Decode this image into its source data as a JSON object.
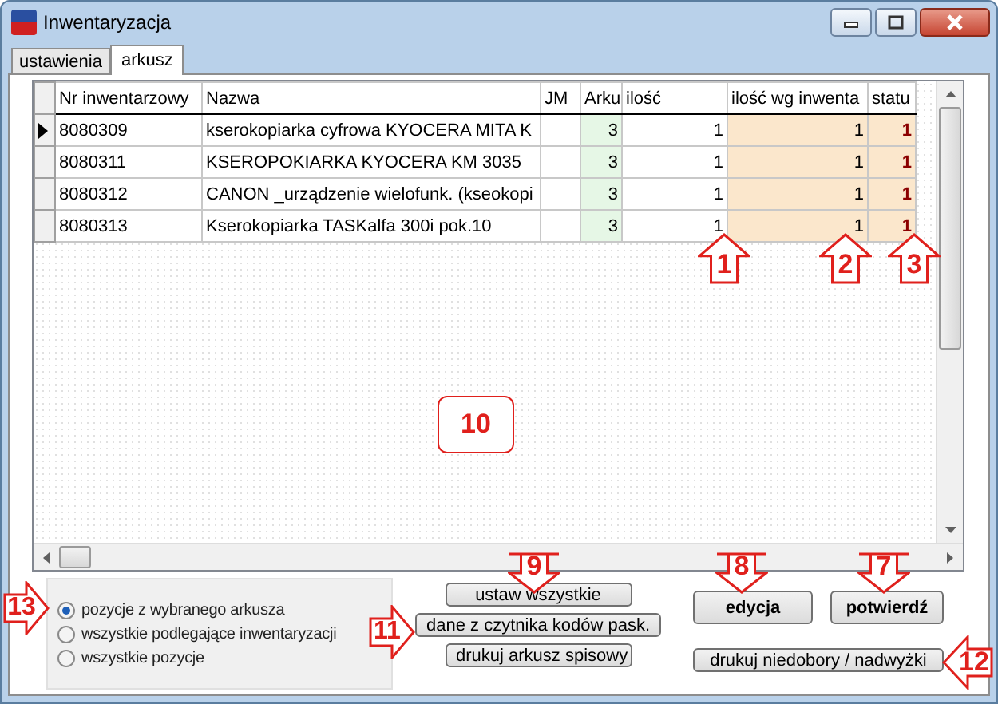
{
  "window": {
    "title": "Inwentaryzacja"
  },
  "tabs": [
    {
      "label": "ustawienia",
      "selected": false
    },
    {
      "label": "arkusz",
      "selected": true
    }
  ],
  "table": {
    "columns": [
      "Nr inwentarzowy",
      "Nazwa",
      "JM",
      "Arku",
      "ilość",
      "ilość wg inwenta",
      "statu"
    ],
    "rows": [
      {
        "current": true,
        "cells": [
          "8080309",
          "kserokopiarka cyfrowa KYOCERA MITA K",
          "",
          "3",
          "1",
          "1",
          "1"
        ]
      },
      {
        "current": false,
        "cells": [
          "8080311",
          "KSEROPOKIARKA KYOCERA KM 3035",
          "",
          "3",
          "1",
          "1",
          "1"
        ]
      },
      {
        "current": false,
        "cells": [
          "8080312",
          "CANON _urządzenie  wielofunk. (kseokopi",
          "",
          "3",
          "1",
          "1",
          "1"
        ]
      },
      {
        "current": false,
        "cells": [
          "8080313",
          "Kserokopiarka TASKalfa 300i pok.10",
          "",
          "3",
          "1",
          "1",
          "1"
        ]
      }
    ]
  },
  "filter": [
    {
      "label": "pozycje z wybranego arkusza",
      "selected": true
    },
    {
      "label": "wszystkie podlegające inwentaryzacji",
      "selected": false
    },
    {
      "label": "wszystkie pozycje",
      "selected": false
    }
  ],
  "middle_buttons": [
    "ustaw wszystkie",
    "dane z czytnika kodów pask.",
    "drukuj arkusz spisowy"
  ],
  "right_buttons": [
    "edycja",
    "potwierdź",
    "drukuj niedobory / nadwyżki"
  ],
  "callouts": [
    {
      "number": "1",
      "kind": "up"
    },
    {
      "number": "2",
      "kind": "up"
    },
    {
      "number": "3",
      "kind": "up"
    },
    {
      "number": "10",
      "kind": "box"
    },
    {
      "number": "9",
      "kind": "down"
    },
    {
      "number": "8",
      "kind": "down"
    },
    {
      "number": "7",
      "kind": "down"
    },
    {
      "number": "13",
      "kind": "right"
    },
    {
      "number": "11",
      "kind": "right"
    },
    {
      "number": "12",
      "kind": "left"
    }
  ]
}
